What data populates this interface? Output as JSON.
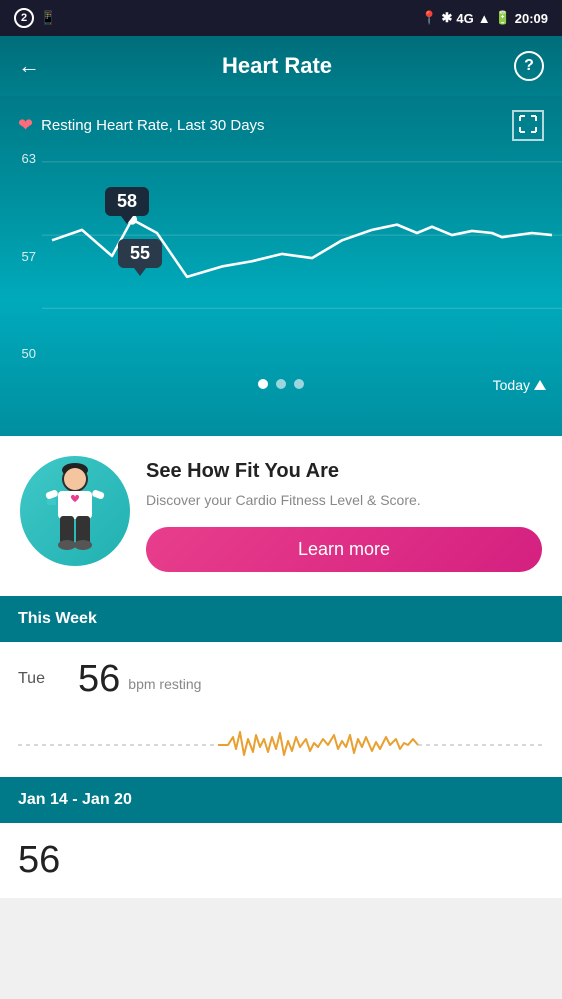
{
  "status_bar": {
    "left_icons": [
      "2",
      "phone"
    ],
    "time": "20:09",
    "right_icons": [
      "location",
      "bluetooth",
      "4G",
      "R",
      "signal",
      "battery"
    ]
  },
  "header": {
    "back_label": "←",
    "title": "Heart Rate",
    "help_label": "?"
  },
  "chart": {
    "label": "Resting Heart Rate, Last 30 Days",
    "y_labels": [
      "63",
      "57",
      "50"
    ],
    "callout_high": "58",
    "callout_low": "55",
    "dots": [
      true,
      false,
      false
    ],
    "today_label": "Today"
  },
  "fitness_card": {
    "title": "See How Fit You Are",
    "description": "Discover your Cardio Fitness Level & Score.",
    "cta_label": "Learn more"
  },
  "this_week": {
    "section_label": "This Week",
    "day": "Tue",
    "bpm_value": "56",
    "bpm_unit": "bpm resting"
  },
  "date_range": {
    "section_label": "Jan 14 - Jan 20",
    "bottom_value": "56"
  }
}
